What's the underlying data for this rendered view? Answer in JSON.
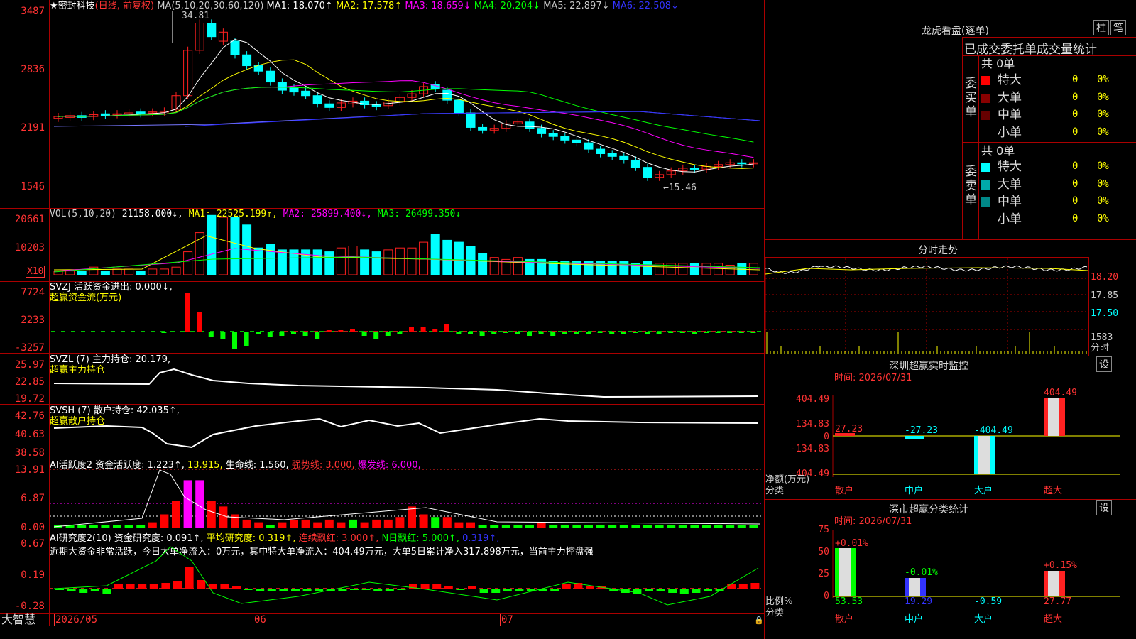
{
  "colors": {
    "up": "#ff2020",
    "down": "#00ffff",
    "ma1": "#ffffff",
    "ma2": "#ffff00",
    "ma3": "#ff00ff",
    "ma4": "#00ff00",
    "ma5": "#9999ff",
    "axis": "#ff3333",
    "grid": "#aa0000",
    "green": "#00ff00",
    "magenta": "#ff00ff",
    "yellow": "#ffff00"
  },
  "main": {
    "title": "★密封科技",
    "mode": "(日线, 前复权)",
    "ma_params": "MA(5,10,20,30,60,120)",
    "ma": [
      {
        "t": "MA1: 18.070↑"
      },
      {
        "t": "MA2: 17.578↑"
      },
      {
        "t": "MA3: 18.659↓"
      },
      {
        "t": "MA4: 20.204↓"
      },
      {
        "t": "MA5: 22.897↓"
      },
      {
        "t": "MA6: 22.508↓"
      }
    ],
    "y_ticks": [
      "3487",
      "2836",
      "2191",
      "1546"
    ],
    "high_label": "34.81",
    "low_label": "←15.46"
  },
  "vol": {
    "header": "VOL(5,10,20)",
    "v": "21158.000↓",
    "ma1": "MA1: 22525.199↑",
    "ma2": "MA2: 25899.400↓",
    "ma3": "MA3: 26499.350↓",
    "y_ticks": [
      "20661",
      "10203"
    ],
    "unit": "X10"
  },
  "svzj": {
    "header": "SVZJ  活跃资金进出: 0.000↓,",
    "sub": "超赢资金流(万元)",
    "y_ticks": [
      "7724",
      "2233",
      "-3257"
    ]
  },
  "svzl": {
    "header": "SVZL (7) 主力持仓: 20.179,",
    "sub": "超赢主力持仓",
    "y_ticks": [
      "25.97",
      "22.85",
      "19.72"
    ]
  },
  "svsh": {
    "header": "SVSH (7) 散户持仓: 42.035↑,",
    "sub": "超赢散户持仓",
    "y_ticks": [
      "42.76",
      "40.63",
      "38.58"
    ]
  },
  "ai1": {
    "header": "AI活跃度2 资金活跃度: 1.223↑,",
    "v2": "13.915,",
    "v3": "生命线: 1.560,",
    "v4": "强势线: 3.000,",
    "v5": "爆发线: 6.000,",
    "y_ticks": [
      "13.91",
      "6.87",
      "0.00"
    ]
  },
  "ai2": {
    "header": "AI研究度2(10) 资金研究度: 0.091↑,",
    "v2": "平均研究度: 0.319↑,",
    "v3": "连续飘红: 3.000↑,",
    "v4": "N日飘红: 5.000↑,",
    "v5": "0.319↑,",
    "note": "近期大资金非常活跃，今日大单净流入：0万元，其中特大单净流入：404.49万元，大单5日累计净入317.898万元，当前主力控盘强",
    "y_ticks": [
      "0.67",
      "0.19",
      "-0.28"
    ]
  },
  "xaxis": {
    "brand": "大智慧",
    "ticks": [
      "2026/05",
      "06",
      "07"
    ]
  },
  "longhu": {
    "title": "龙虎看盘(逐单)",
    "btn1": "柱",
    "btn2": "笔",
    "header": "已成交委托单成交量统计",
    "buy": {
      "total": "共 0单",
      "side": "委买单",
      "rows": [
        {
          "name": "特大",
          "v": "0",
          "p": "0%"
        },
        {
          "name": "大单",
          "v": "0",
          "p": "0%"
        },
        {
          "name": "中单",
          "v": "0",
          "p": "0%"
        },
        {
          "name": "小单",
          "v": "0",
          "p": "0%"
        }
      ]
    },
    "sell": {
      "total": "共 0单",
      "side": "委卖单",
      "rows": [
        {
          "name": "特大",
          "v": "0",
          "p": "0%"
        },
        {
          "name": "大单",
          "v": "0",
          "p": "0%"
        },
        {
          "name": "中单",
          "v": "0",
          "p": "0%"
        },
        {
          "name": "小单",
          "v": "0",
          "p": "0%"
        }
      ]
    }
  },
  "fenshi": {
    "title": "分时走势",
    "ticks": [
      "18.20",
      "17.85",
      "17.50",
      "1583",
      "分时"
    ]
  },
  "sz_monitor": {
    "title": "深圳超赢实时监控",
    "btn": "设",
    "date": "时间: 2026/07/31",
    "y_ticks": [
      "404.49",
      "134.83",
      "0",
      "-134.83",
      "-404.49"
    ],
    "unit": "净额(万元)",
    "cls": "分类",
    "cats": [
      "散户",
      "中户",
      "大户",
      "超大"
    ],
    "vals": [
      "27.23",
      "-27.23",
      "-404.49",
      "404.49"
    ]
  },
  "sz_class": {
    "title": "深市超赢分类统计",
    "btn": "设",
    "date": "时间: 2026/07/31",
    "y_ticks": [
      "75",
      "50",
      "25",
      "0"
    ],
    "unit": "比例%",
    "cls": "分类",
    "cats": [
      "散户",
      "中户",
      "大户",
      "超大"
    ],
    "top": [
      "+0.01%",
      "-0.01%",
      "",
      "+0.15%"
    ],
    "bottom": [
      "53.53",
      "19.29",
      "-0.59",
      "27.77"
    ]
  }
}
